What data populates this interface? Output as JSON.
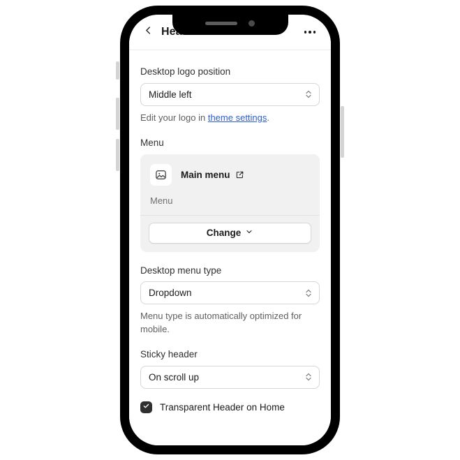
{
  "device": {
    "notch_speaker": "earpiece-speaker",
    "notch_camera": "front-camera",
    "side_buttons": [
      "silence-switch",
      "volume-up",
      "volume-down",
      "power"
    ]
  },
  "header": {
    "back_icon": "chevron-left-icon",
    "title": "Header",
    "more_icon": "more-horizontal-icon"
  },
  "sections": {
    "desktop_logo_position": {
      "label": "Desktop logo position",
      "value": "Middle left",
      "help_prefix": "Edit your logo in ",
      "help_link": "theme settings",
      "help_suffix": "."
    },
    "menu": {
      "label": "Menu",
      "thumb_icon": "image-placeholder-icon",
      "resource_title": "Main menu",
      "external_icon": "external-link-icon",
      "resource_subtitle": "Menu",
      "change_label": "Change",
      "change_icon": "chevron-down-icon"
    },
    "desktop_menu_type": {
      "label": "Desktop menu type",
      "value": "Dropdown",
      "help": "Menu type is automatically optimized for mobile."
    },
    "sticky_header": {
      "label": "Sticky header",
      "value": "On scroll up"
    },
    "transparent_header": {
      "label": "Transparent Header on Home",
      "checked": true,
      "check_icon": "check-icon"
    }
  },
  "colors": {
    "accent_link": "#2c5ecf",
    "card_bg": "#f1f1f1",
    "checkbox_fill": "#303030",
    "text_primary": "#1a1a1a",
    "text_secondary": "#6d7175"
  }
}
